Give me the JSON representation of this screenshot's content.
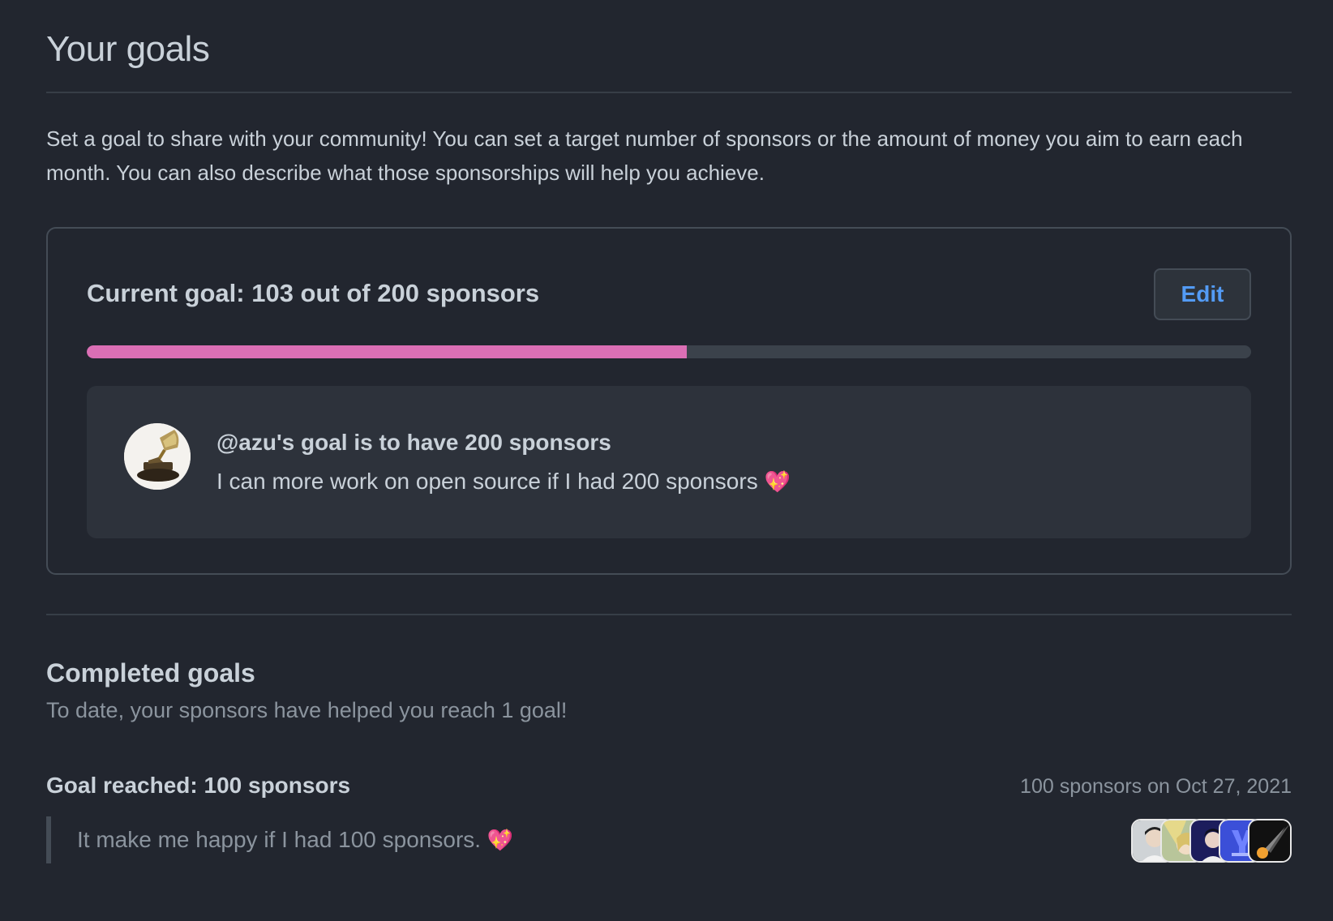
{
  "page": {
    "title": "Your goals",
    "intro": "Set a goal to share with your community! You can set a target number of sponsors or the amount of money you aim to earn each month. You can also describe what those sponsorships will help you achieve."
  },
  "current_goal": {
    "heading": "Current goal: 103 out of 200 sponsors",
    "edit_label": "Edit",
    "progress": {
      "current": 103,
      "target": 200,
      "fraction": 0.515
    },
    "card": {
      "title": "@azu's goal is to have 200 sponsors",
      "description": "I can more work on open source if I had 200 sponsors",
      "emoji": "💖"
    }
  },
  "completed": {
    "title": "Completed goals",
    "subtitle": "To date, your sponsors have helped you reach 1 goal!",
    "goals": [
      {
        "title": "Goal reached: 100 sponsors",
        "meta": "100 sponsors on Oct 27, 2021",
        "quote": "It make me happy if I had 100 sponsors.",
        "emoji": "💖",
        "avatars": [
          "sponsor-avatar-1",
          "sponsor-avatar-2",
          "sponsor-avatar-3",
          "sponsor-avatar-4",
          "sponsor-avatar-5"
        ]
      }
    ]
  },
  "colors": {
    "background": "#22262f",
    "progress_fill": "#db6fb5",
    "progress_track": "#3b424b",
    "link": "#539bf5"
  }
}
